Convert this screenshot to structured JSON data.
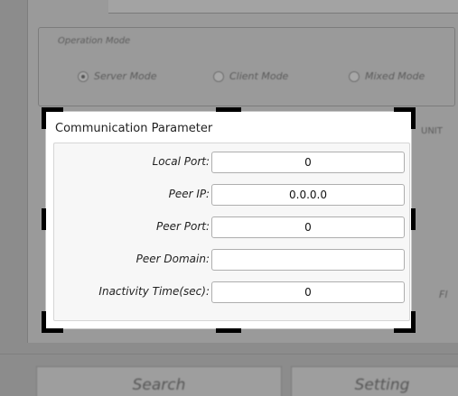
{
  "background": {
    "operation_mode_label": "Operation Mode",
    "modes": [
      {
        "label": "Server Mode",
        "selected": true
      },
      {
        "label": "Client Mode",
        "selected": false
      },
      {
        "label": "Mixed Mode",
        "selected": false
      }
    ],
    "side_labels": [
      "UNIT",
      "Fl"
    ],
    "buttons": [
      "Search",
      "Setting"
    ]
  },
  "dialog": {
    "title": "Communication Parameter",
    "fields": [
      {
        "label": "Local Port:",
        "value": "0"
      },
      {
        "label": "Peer IP:",
        "value": "0.0.0.0"
      },
      {
        "label": "Peer Port:",
        "value": "0"
      },
      {
        "label": "Peer Domain:",
        "value": ""
      },
      {
        "label": "Inactivity Time(sec):",
        "value": "0"
      }
    ]
  }
}
